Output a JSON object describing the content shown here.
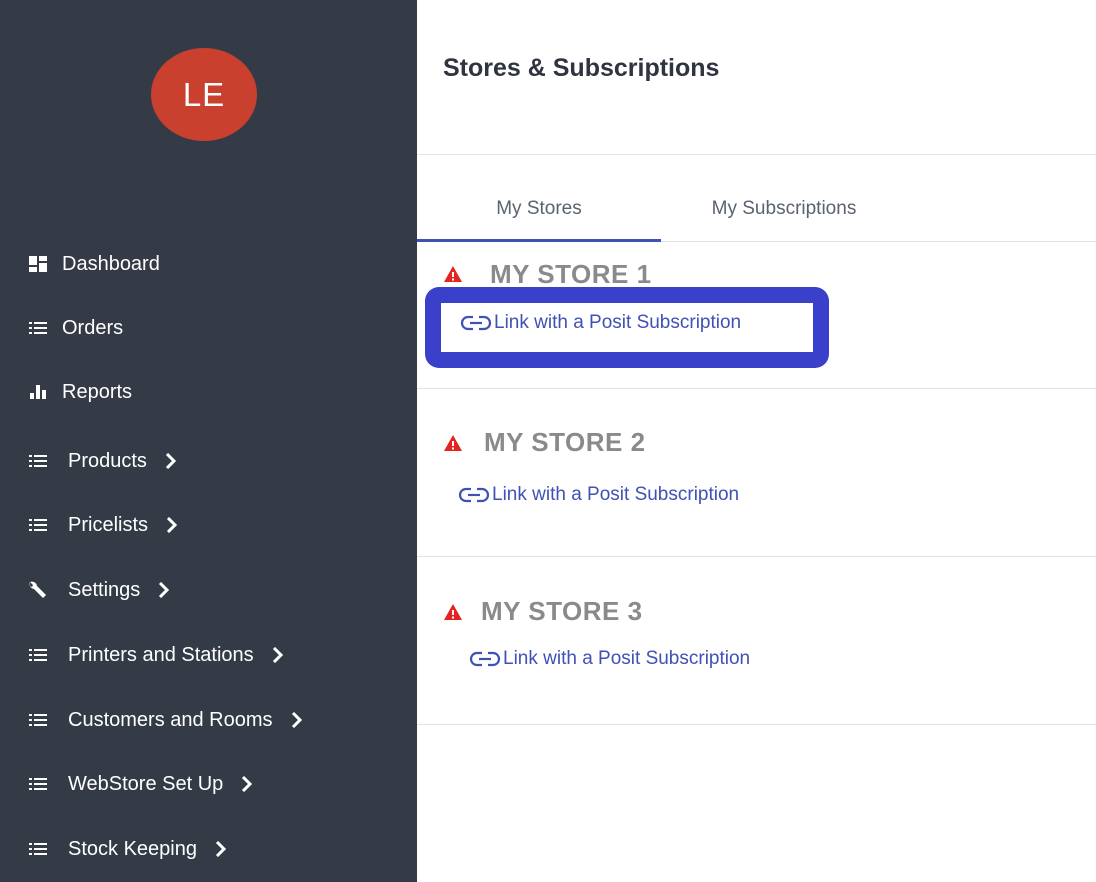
{
  "user": {
    "initials": "LE"
  },
  "sidebar": {
    "items": [
      {
        "label": "Dashboard",
        "icon": "dashboard-icon"
      },
      {
        "label": "Orders",
        "icon": "list-icon"
      },
      {
        "label": "Reports",
        "icon": "bar-chart-icon"
      },
      {
        "label": "Products",
        "icon": "list-icon",
        "expandable": true
      },
      {
        "label": "Pricelists",
        "icon": "list-icon",
        "expandable": true
      },
      {
        "label": "Settings",
        "icon": "wrench-icon",
        "expandable": true
      },
      {
        "label": "Printers and Stations",
        "icon": "list-icon",
        "expandable": true
      },
      {
        "label": "Customers and Rooms",
        "icon": "list-icon",
        "expandable": true
      },
      {
        "label": "WebStore Set Up",
        "icon": "list-icon",
        "expandable": true
      },
      {
        "label": "Stock Keeping",
        "icon": "list-icon",
        "expandable": true
      }
    ]
  },
  "page": {
    "title": "Stores & Subscriptions"
  },
  "tabs": [
    {
      "label": "My Stores",
      "active": true
    },
    {
      "label": "My Subscriptions",
      "active": false
    }
  ],
  "stores": [
    {
      "name": "MY STORE 1",
      "link_label": "Link with a Posit Subscription"
    },
    {
      "name": "MY STORE 2",
      "link_label": "Link with a Posit Subscription"
    },
    {
      "name": "MY STORE 3",
      "link_label": "Link with a Posit Subscription"
    }
  ],
  "colors": {
    "sidebar_bg": "#343b47",
    "avatar_bg": "#c9402f",
    "accent": "#3f51b5",
    "warning": "#e52421",
    "highlight": "#3a40c9"
  }
}
